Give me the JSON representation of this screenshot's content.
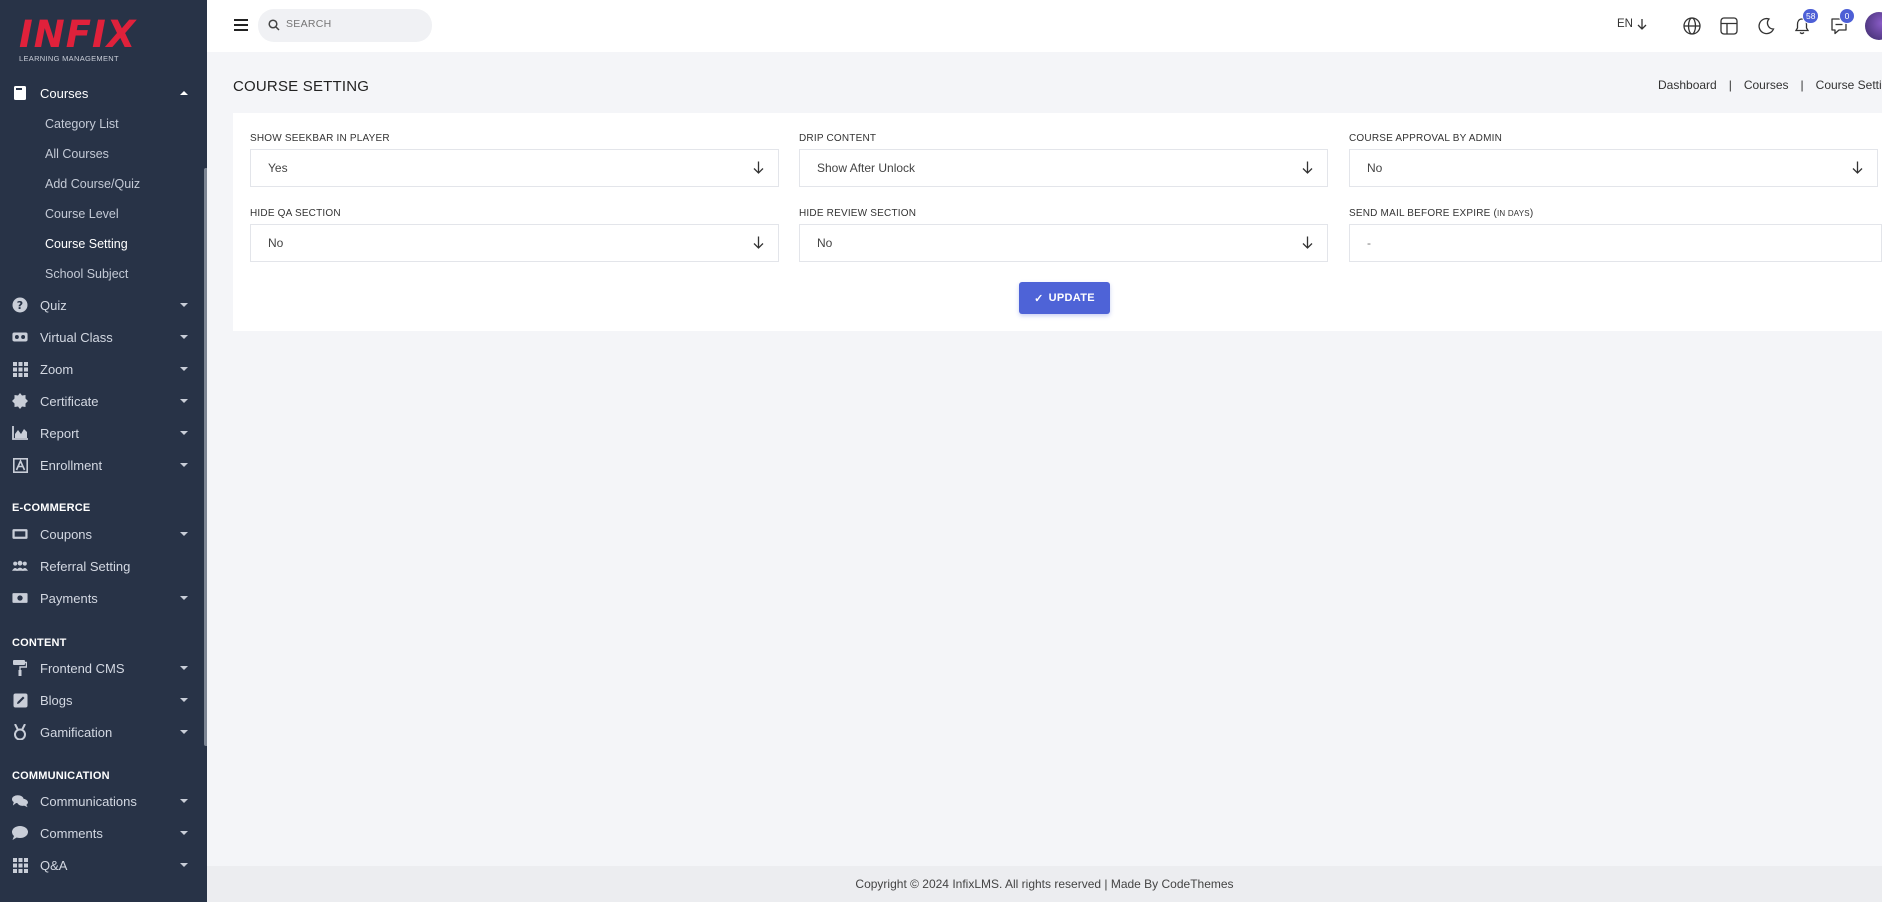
{
  "brand": {
    "name": "INFIX",
    "subtitle": "LEARNING MANAGEMENT"
  },
  "sidebar": {
    "courses": {
      "label": "Courses",
      "children": [
        "Category List",
        "All Courses",
        "Add Course/Quiz",
        "Course Level",
        "Course Setting",
        "School Subject"
      ]
    },
    "items": [
      {
        "label": "Quiz",
        "icon": "question-circle-icon"
      },
      {
        "label": "Virtual Class",
        "icon": "vr-headset-icon"
      },
      {
        "label": "Zoom",
        "icon": "grid-icon"
      },
      {
        "label": "Certificate",
        "icon": "certificate-icon"
      },
      {
        "label": "Report",
        "icon": "chart-area-icon"
      },
      {
        "label": "Enrollment",
        "icon": "enrollment-icon"
      }
    ],
    "ecommerce_title": "E-COMMERCE",
    "ecommerce": [
      {
        "label": "Coupons",
        "icon": "ticket-icon"
      },
      {
        "label": "Referral Setting",
        "icon": "users-icon"
      },
      {
        "label": "Payments",
        "icon": "money-icon"
      }
    ],
    "content_title": "CONTENT",
    "content": [
      {
        "label": "Frontend CMS",
        "icon": "paint-roller-icon"
      },
      {
        "label": "Blogs",
        "icon": "edit-icon"
      },
      {
        "label": "Gamification",
        "icon": "medal-icon"
      }
    ],
    "communication_title": "COMMUNICATION",
    "communication": [
      {
        "label": "Communications",
        "icon": "chat-icon"
      },
      {
        "label": "Comments",
        "icon": "comment-icon"
      },
      {
        "label": "Q&A",
        "icon": "grid-icon"
      }
    ]
  },
  "topbar": {
    "search_placeholder": "SEARCH",
    "language": "EN",
    "notifications_count": "58",
    "messages_count": "0"
  },
  "page": {
    "title": "COURSE SETTING",
    "breadcrumb": [
      "Dashboard",
      "Courses",
      "Course Setti"
    ]
  },
  "form": {
    "show_seekbar": {
      "label": "SHOW SEEKBAR IN PLAYER",
      "value": "Yes"
    },
    "drip_content": {
      "label": "DRIP CONTENT",
      "value": "Show After Unlock"
    },
    "course_approval": {
      "label": "COURSE APPROVAL BY ADMIN",
      "value": "No"
    },
    "hide_qa": {
      "label": "HIDE QA SECTION",
      "value": "No"
    },
    "hide_review": {
      "label": "HIDE REVIEW SECTION",
      "value": "No"
    },
    "send_mail": {
      "label": "SEND MAIL BEFORE EXPIRE (",
      "label_small": "IN DAYS",
      "label_end": ")",
      "value": "-"
    },
    "update_label": "UPDATE"
  },
  "footer": {
    "text": "Copyright © 2024 InfixLMS. All rights reserved | Made By CodeThemes"
  },
  "colors": {
    "sidebar_bg": "#283347",
    "accent": "#4e63d7",
    "brand_red": "#e0213b"
  }
}
